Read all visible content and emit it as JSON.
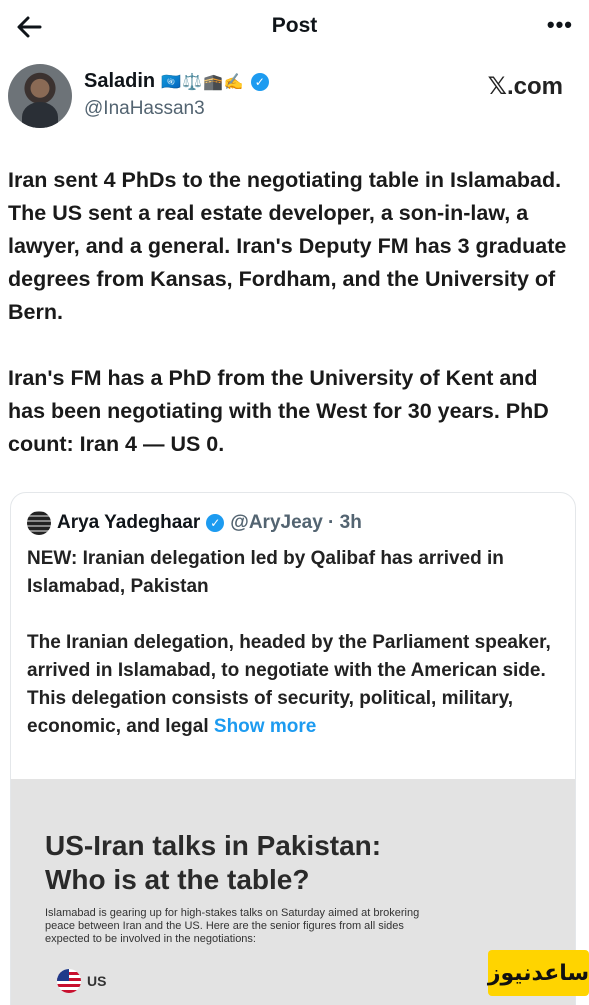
{
  "header": {
    "title": "Post",
    "back_icon": "arrow-left-icon",
    "more_icon": "more-horizontal-icon",
    "more_glyph": "•••"
  },
  "author": {
    "name": "Saladin",
    "emojis": "🇺🇳⚖️🕋✍️",
    "verified_glyph": "✓",
    "handle": "@InaHassan3",
    "site": "𝕏.com"
  },
  "post": {
    "paragraphs": [
      "Iran sent 4 PhDs to the negotiating table in Islamabad. The US sent a real estate developer, a son-in-law, a lawyer, and a general. Iran's Deputy FM has 3 graduate degrees from Kansas, Fordham, and the University of Bern.",
      "Iran's FM has a PhD from the University of Kent and has been negotiating with the West for 30 years. PhD count: Iran 4 — US 0."
    ]
  },
  "quote": {
    "name": "Arya Yadeghaar",
    "handle_time": "@AryJeay · 3h",
    "verified_glyph": "✓",
    "paragraph1": "NEW: Iranian delegation led by Qalibaf has arrived in Islamabad, Pakistan",
    "paragraph2": "The Iranian delegation, headed by the Parliament speaker, arrived in Islamabad, to negotiate with the American side. This delegation consists of security, political, military, economic, and legal",
    "show_more": "Show more",
    "infographic": {
      "title_line1": "US-Iran talks in Pakistan:",
      "title_line2": "Who is at the table?",
      "subtitle": "Islamabad is gearing up for high-stakes talks on Saturday aimed at brokering peace between Iran and the US. Here are the senior figures from all sides expected to be involved in the negotiations:",
      "country_label": "US"
    }
  },
  "watermark": {
    "text": "ساعدنیوز",
    "color": "#ffd400"
  },
  "colors": {
    "accent": "#1d9bf0",
    "text": "#0f1419",
    "muted": "#536471"
  }
}
